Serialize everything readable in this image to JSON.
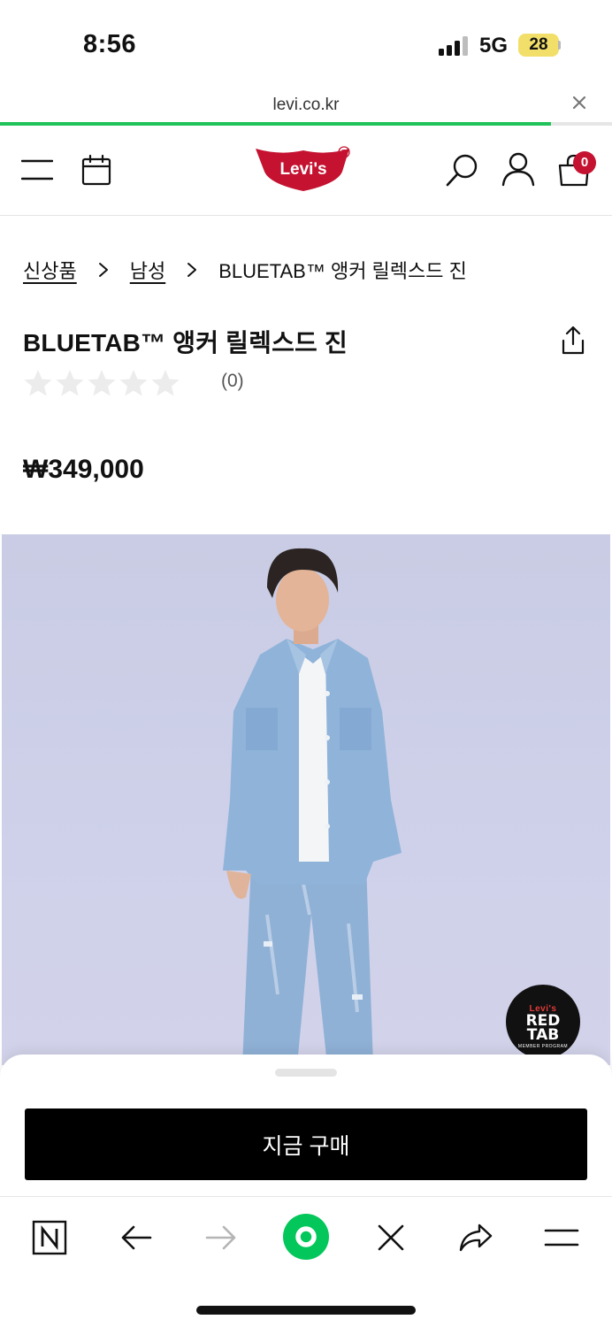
{
  "status_bar": {
    "time": "8:56",
    "network": "5G",
    "battery": "28"
  },
  "browser": {
    "url": "levi.co.kr",
    "load_progress": 0.9
  },
  "header": {
    "logo_text": "Levi's",
    "cart_count": "0",
    "icons": [
      "menu-icon",
      "calendar-icon",
      "search-icon",
      "account-icon",
      "cart-icon"
    ]
  },
  "breadcrumb": {
    "items": [
      "신상품",
      "남성"
    ],
    "current": "BLUETAB™ 앵커 릴렉스드 진"
  },
  "product": {
    "title": "BLUETAB™ 앵커 릴렉스드 진",
    "rating": 0,
    "rating_max": 5,
    "review_count": "(0)",
    "price_currency": "₩",
    "price": "349,000"
  },
  "badge": {
    "line1": "Levi's",
    "line2": "RED",
    "line3": "TAB",
    "line4": "MEMBER PROGRAM"
  },
  "sheet": {
    "buy_label": "지금 구매"
  },
  "toolbar": {
    "items": [
      "naver-icon",
      "back-icon",
      "forward-icon",
      "home-icon",
      "close-icon",
      "share-icon",
      "menu-icon"
    ]
  },
  "colors": {
    "brand_red": "#c41230",
    "progress_green": "#1fc35a",
    "naver_green": "#03c75a",
    "hero_background": "#cbcde6"
  }
}
